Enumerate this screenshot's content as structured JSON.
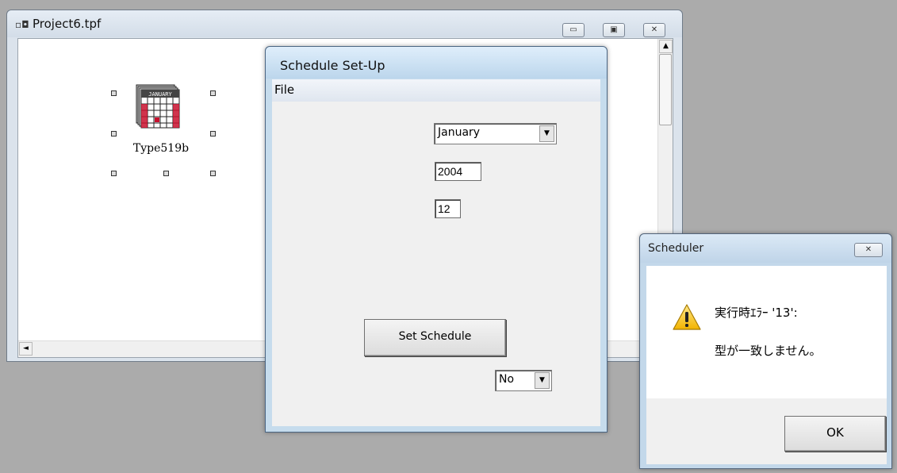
{
  "project_window": {
    "title": "Project6.tpf",
    "title_icon": "project-icon",
    "component_label": "Type519b",
    "calendar_icon_text": "JANUARY"
  },
  "schedule_window": {
    "title": "Schedule Set-Up",
    "menu": {
      "file": "File"
    },
    "month_select": {
      "value": "January"
    },
    "year_input": {
      "value": "2004"
    },
    "day_input": {
      "value": "12"
    },
    "set_schedule_button": "Set Schedule",
    "yesno_select": {
      "value": "No"
    }
  },
  "dialog": {
    "title": "Scheduler",
    "message_line1": "実行時ｴﾗｰ '13':",
    "message_line2": "型が一致しません。",
    "ok_button": "OK"
  }
}
